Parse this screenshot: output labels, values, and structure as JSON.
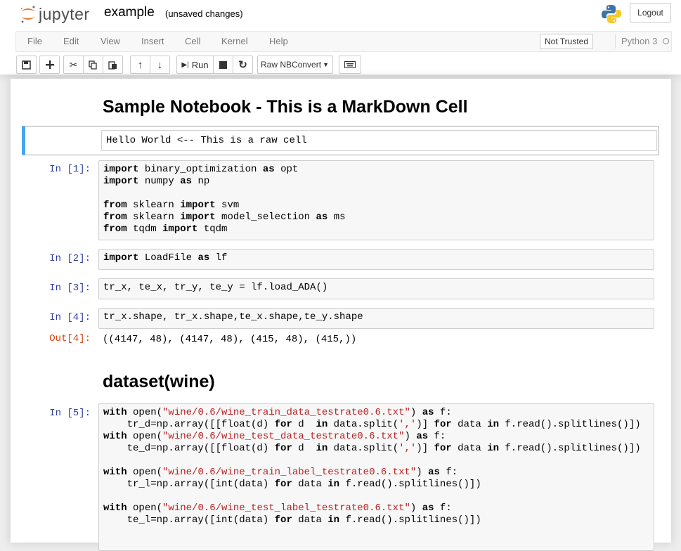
{
  "header": {
    "brand": "jupyter",
    "notebook_name": "example",
    "save_status": "(unsaved changes)",
    "logout_label": "Logout"
  },
  "menubar": {
    "items": [
      "File",
      "Edit",
      "View",
      "Insert",
      "Cell",
      "Kernel",
      "Help"
    ],
    "trust_label": "Not Trusted",
    "kernel_name": "Python 3"
  },
  "toolbar": {
    "run_label": "Run",
    "cell_type": "Raw NBConvert",
    "icons": [
      "save-icon",
      "plus-icon",
      "cut-icon",
      "copy-icon",
      "paste-icon",
      "arrow-up-icon",
      "arrow-down-icon",
      "run-icon",
      "stop-icon",
      "restart-icon",
      "keyboard-icon"
    ]
  },
  "cells": {
    "md1": "Sample Notebook - This is a MarkDown Cell",
    "raw1": "Hello World <-- This is a raw cell",
    "in1_prompt": "In [1]:",
    "in2_prompt": "In [2]:",
    "in3_prompt": "In [3]:",
    "in4_prompt": "In [4]:",
    "out4_prompt": "Out[4]:",
    "out4_text": "((4147, 48), (4147, 48), (415, 48), (415,))",
    "md2": "dataset(wine)",
    "in5_prompt": "In [5]:",
    "in1_code": "import binary_optimization as opt\nimport numpy as np\n\nfrom sklearn import svm\nfrom sklearn import model_selection as ms\nfrom tqdm import tqdm",
    "in2_code": "import LoadFile as lf",
    "in3_code": "tr_x, te_x, tr_y, te_y = lf.load_ADA()",
    "in4_code": "tr_x.shape, tr_x.shape,te_x.shape,te_y.shape",
    "in5_code": "with open(\"wine/0.6/wine_train_data_testrate0.6.txt\") as f:\n    tr_d=np.array([[float(d) for d  in data.split(',')] for data in f.read().splitlines()])\nwith open(\"wine/0.6/wine_test_data_testrate0.6.txt\") as f:\n    te_d=np.array([[float(d) for d  in data.split(',')] for data in f.read().splitlines()])\n\nwith open(\"wine/0.6/wine_train_label_testrate0.6.txt\") as f:\n    tr_l=np.array([int(data) for data in f.read().splitlines()])\n\nwith open(\"wine/0.6/wine_test_label_testrate0.6.txt\") as f:\n    te_l=np.array([int(data) for data in f.read().splitlines()])"
  },
  "colors": {
    "prompt_in": "#303f9f",
    "prompt_out": "#d84315",
    "selected_cell_bar": "#42a5f5",
    "string": "#ba2121"
  }
}
